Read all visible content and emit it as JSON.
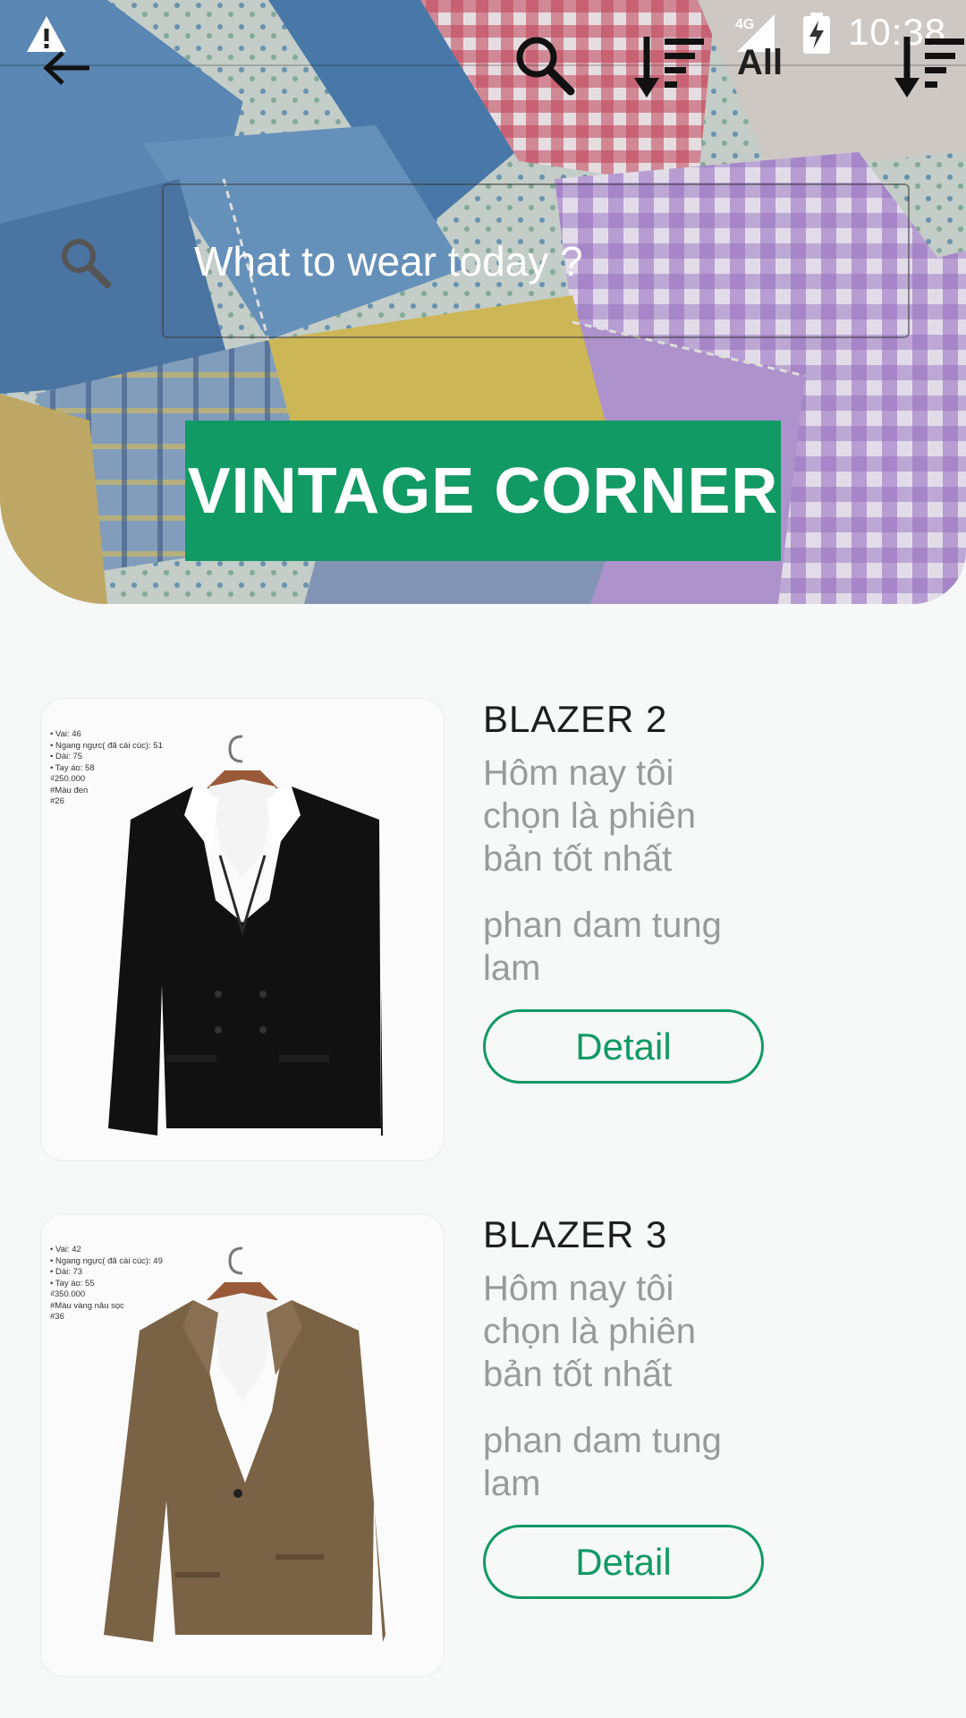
{
  "status_bar": {
    "time": "10:38",
    "network": "4G",
    "icons": [
      "warning-icon",
      "signal-icon",
      "battery-charging-icon"
    ]
  },
  "toolbar": {
    "back_icon": "arrow-left-icon",
    "search_icon": "search-icon",
    "sort_icon": "sort-descending-icon",
    "filter_label": "All",
    "sort_icon_2": "sort-descending-icon"
  },
  "search": {
    "placeholder": "What to wear today ?",
    "icon": "search-icon"
  },
  "brand": {
    "title": "VINTAGE CORNER",
    "color": "#119a64"
  },
  "products": [
    {
      "title": "BLAZER 2",
      "description": "Hôm nay tôi chọn là phiên bản tốt nhất",
      "seller": "phan dam tung lam",
      "button": "Detail",
      "jacket_color": "#111111",
      "spec_lines": [
        "• Vai: 46",
        "• Ngang ngực( đã cài cúc): 51",
        "• Dài: 75",
        "• Tay áo: 58",
        "₫250.000",
        "#Màu đen",
        "#26"
      ]
    },
    {
      "title": "BLAZER 3",
      "description": "Hôm nay tôi chọn là phiên bản tốt nhất",
      "seller": "phan dam tung lam",
      "button": "Detail",
      "jacket_color": "#7a6245",
      "spec_lines": [
        "• Vai: 42",
        "• Ngang ngực( đã cài cúc): 49",
        "• Dài: 73",
        "• Tay áo: 55",
        "₫350.000",
        "#Màu vàng nâu sọc",
        "#36"
      ]
    }
  ]
}
